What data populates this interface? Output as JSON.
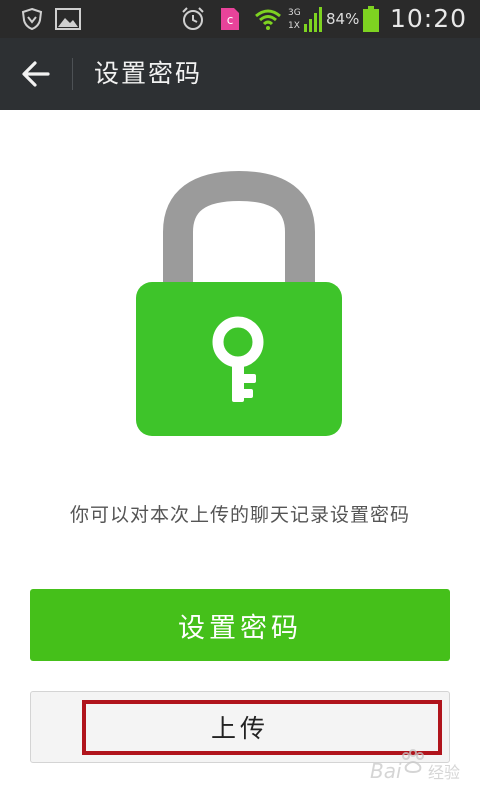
{
  "status_bar": {
    "battery_percent": "84%",
    "time": "10:20",
    "network_labels": [
      "3G",
      "1X"
    ],
    "icons": [
      "shield-icon",
      "gallery-icon",
      "alarm-icon",
      "app-notification-icon",
      "wifi-icon",
      "signal-icon",
      "battery-icon"
    ]
  },
  "action_bar": {
    "title": "设置密码",
    "back_icon": "arrow-left-icon"
  },
  "main": {
    "illustration": "padlock-with-key-icon",
    "description": "你可以对本次上传的聊天记录设置密码",
    "primary_button": "设置密码",
    "secondary_button": "上传"
  },
  "colors": {
    "status_bar_bg": "#2a2a2a",
    "action_bar_bg": "#2d3033",
    "accent_green": "#45c01a",
    "lock_body": "#3ec42a",
    "lock_shackle": "#9a9a9a",
    "highlight_red": "#b0141c"
  }
}
